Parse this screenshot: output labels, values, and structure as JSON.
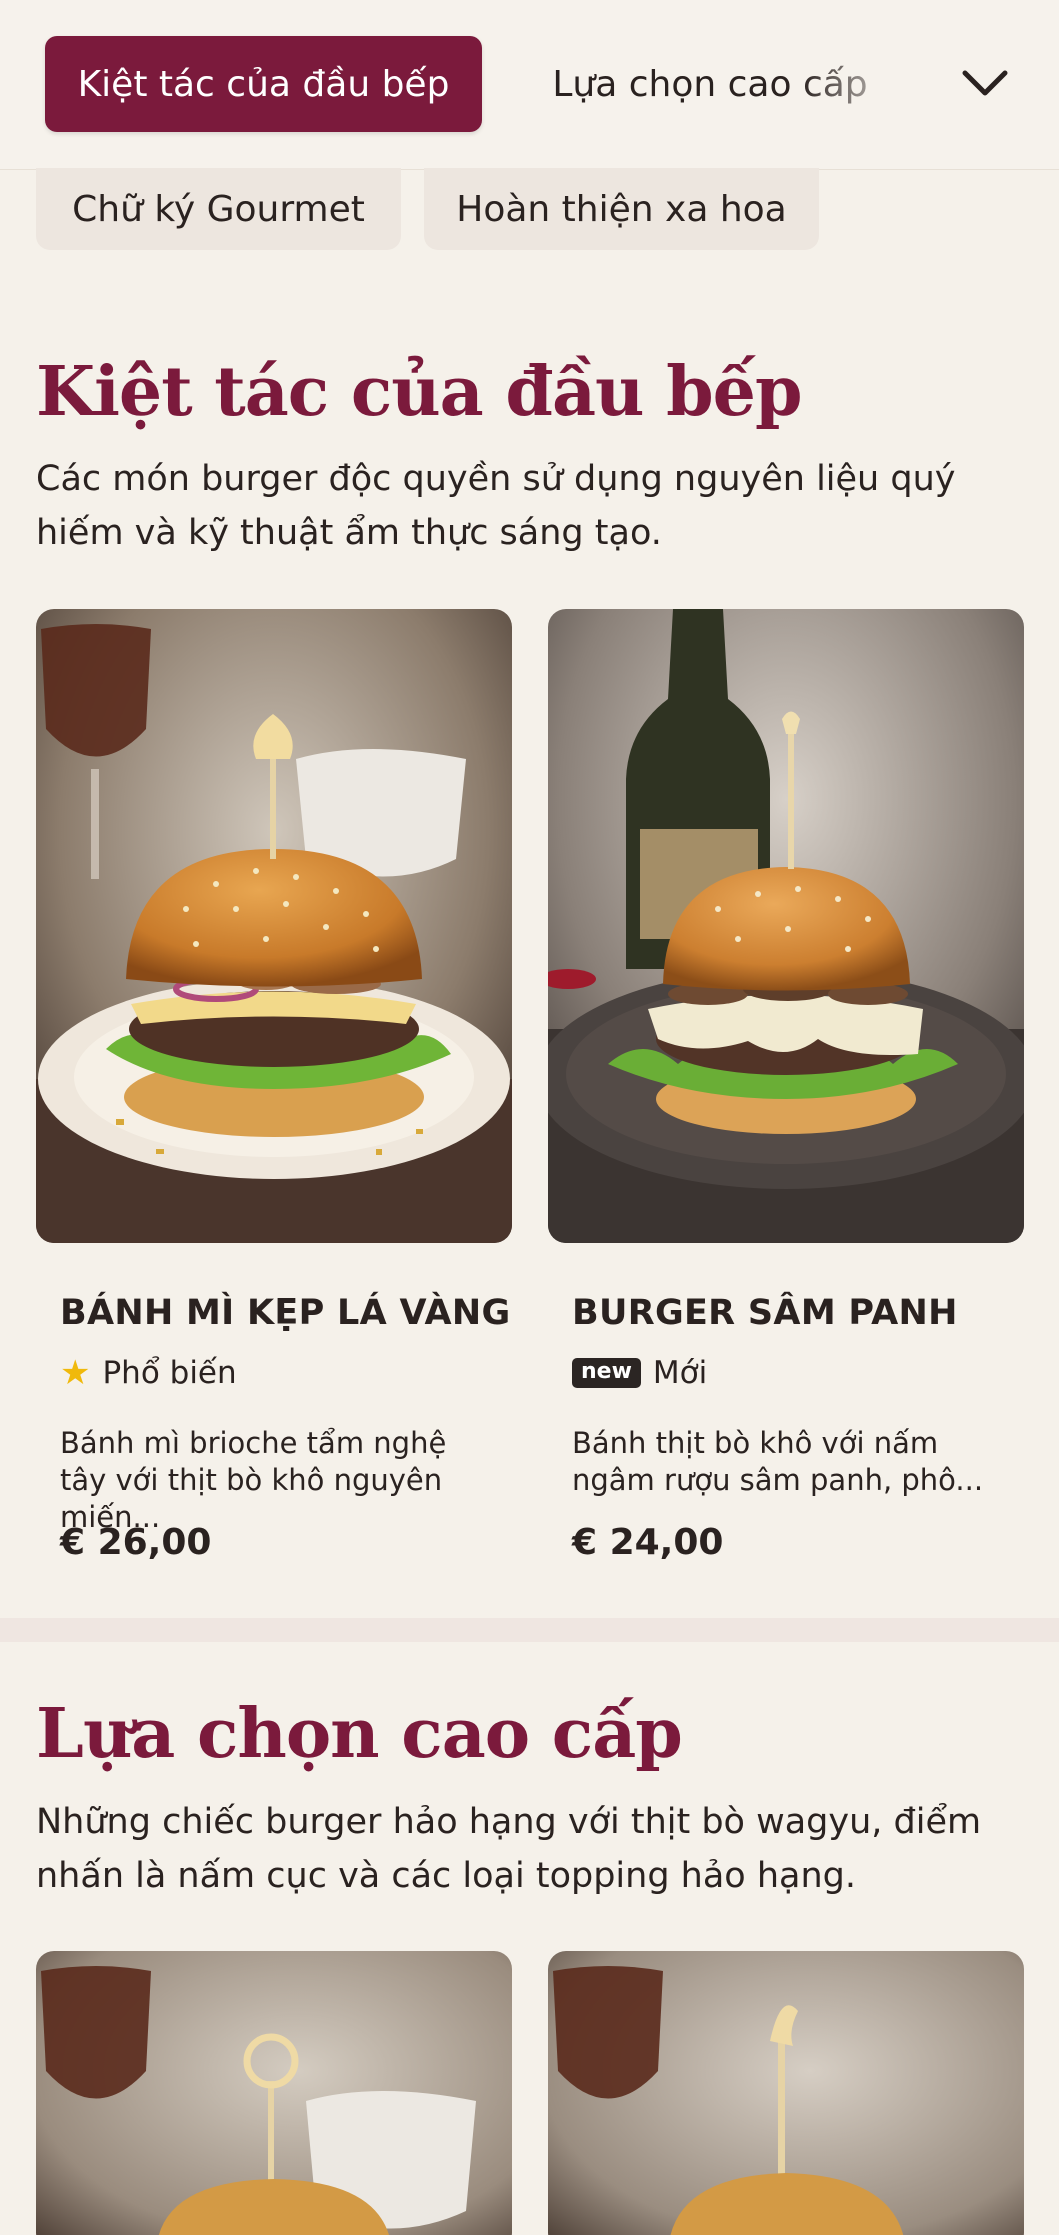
{
  "nav": {
    "active_category": "Kiệt tác của đầu bếp",
    "next_category": "Lựa chọn cao cấp",
    "expand_icon": "chevron-down-icon",
    "sub_categories": [
      "Chữ ký Gourmet",
      "Hoàn thiện xa hoa"
    ]
  },
  "colors": {
    "accent": "#7b1a3c",
    "background": "#f5f1ea",
    "pill_inactive": "#ede6df",
    "star": "#f0b90b"
  },
  "sections": [
    {
      "title": "Kiệt tác của đầu bếp",
      "description": "Các món burger độc quyền sử dụng nguyên liệu quý hiếm và kỹ thuật ẩm thực sáng tạo.",
      "products": [
        {
          "name": "BÁNH MÌ KẸP LÁ VÀNG",
          "tag_icon": "star-icon",
          "tag": "Phổ biến",
          "description": "Bánh mì brioche tẩm nghệ tây với thịt bò khô nguyên miến...",
          "price": "€ 26,00"
        },
        {
          "name": "BURGER SÂM PANH",
          "tag_badge": "new",
          "tag": "Mới",
          "description": "Bánh thịt bò khô với nấm ngâm rượu sâm panh, phô...",
          "price": "€ 24,00"
        }
      ]
    },
    {
      "title": "Lựa chọn cao cấp",
      "description": "Những chiếc burger hảo hạng với thịt bò wagyu, điểm nhấn là nấm cục và các loại topping hảo hạng."
    }
  ]
}
